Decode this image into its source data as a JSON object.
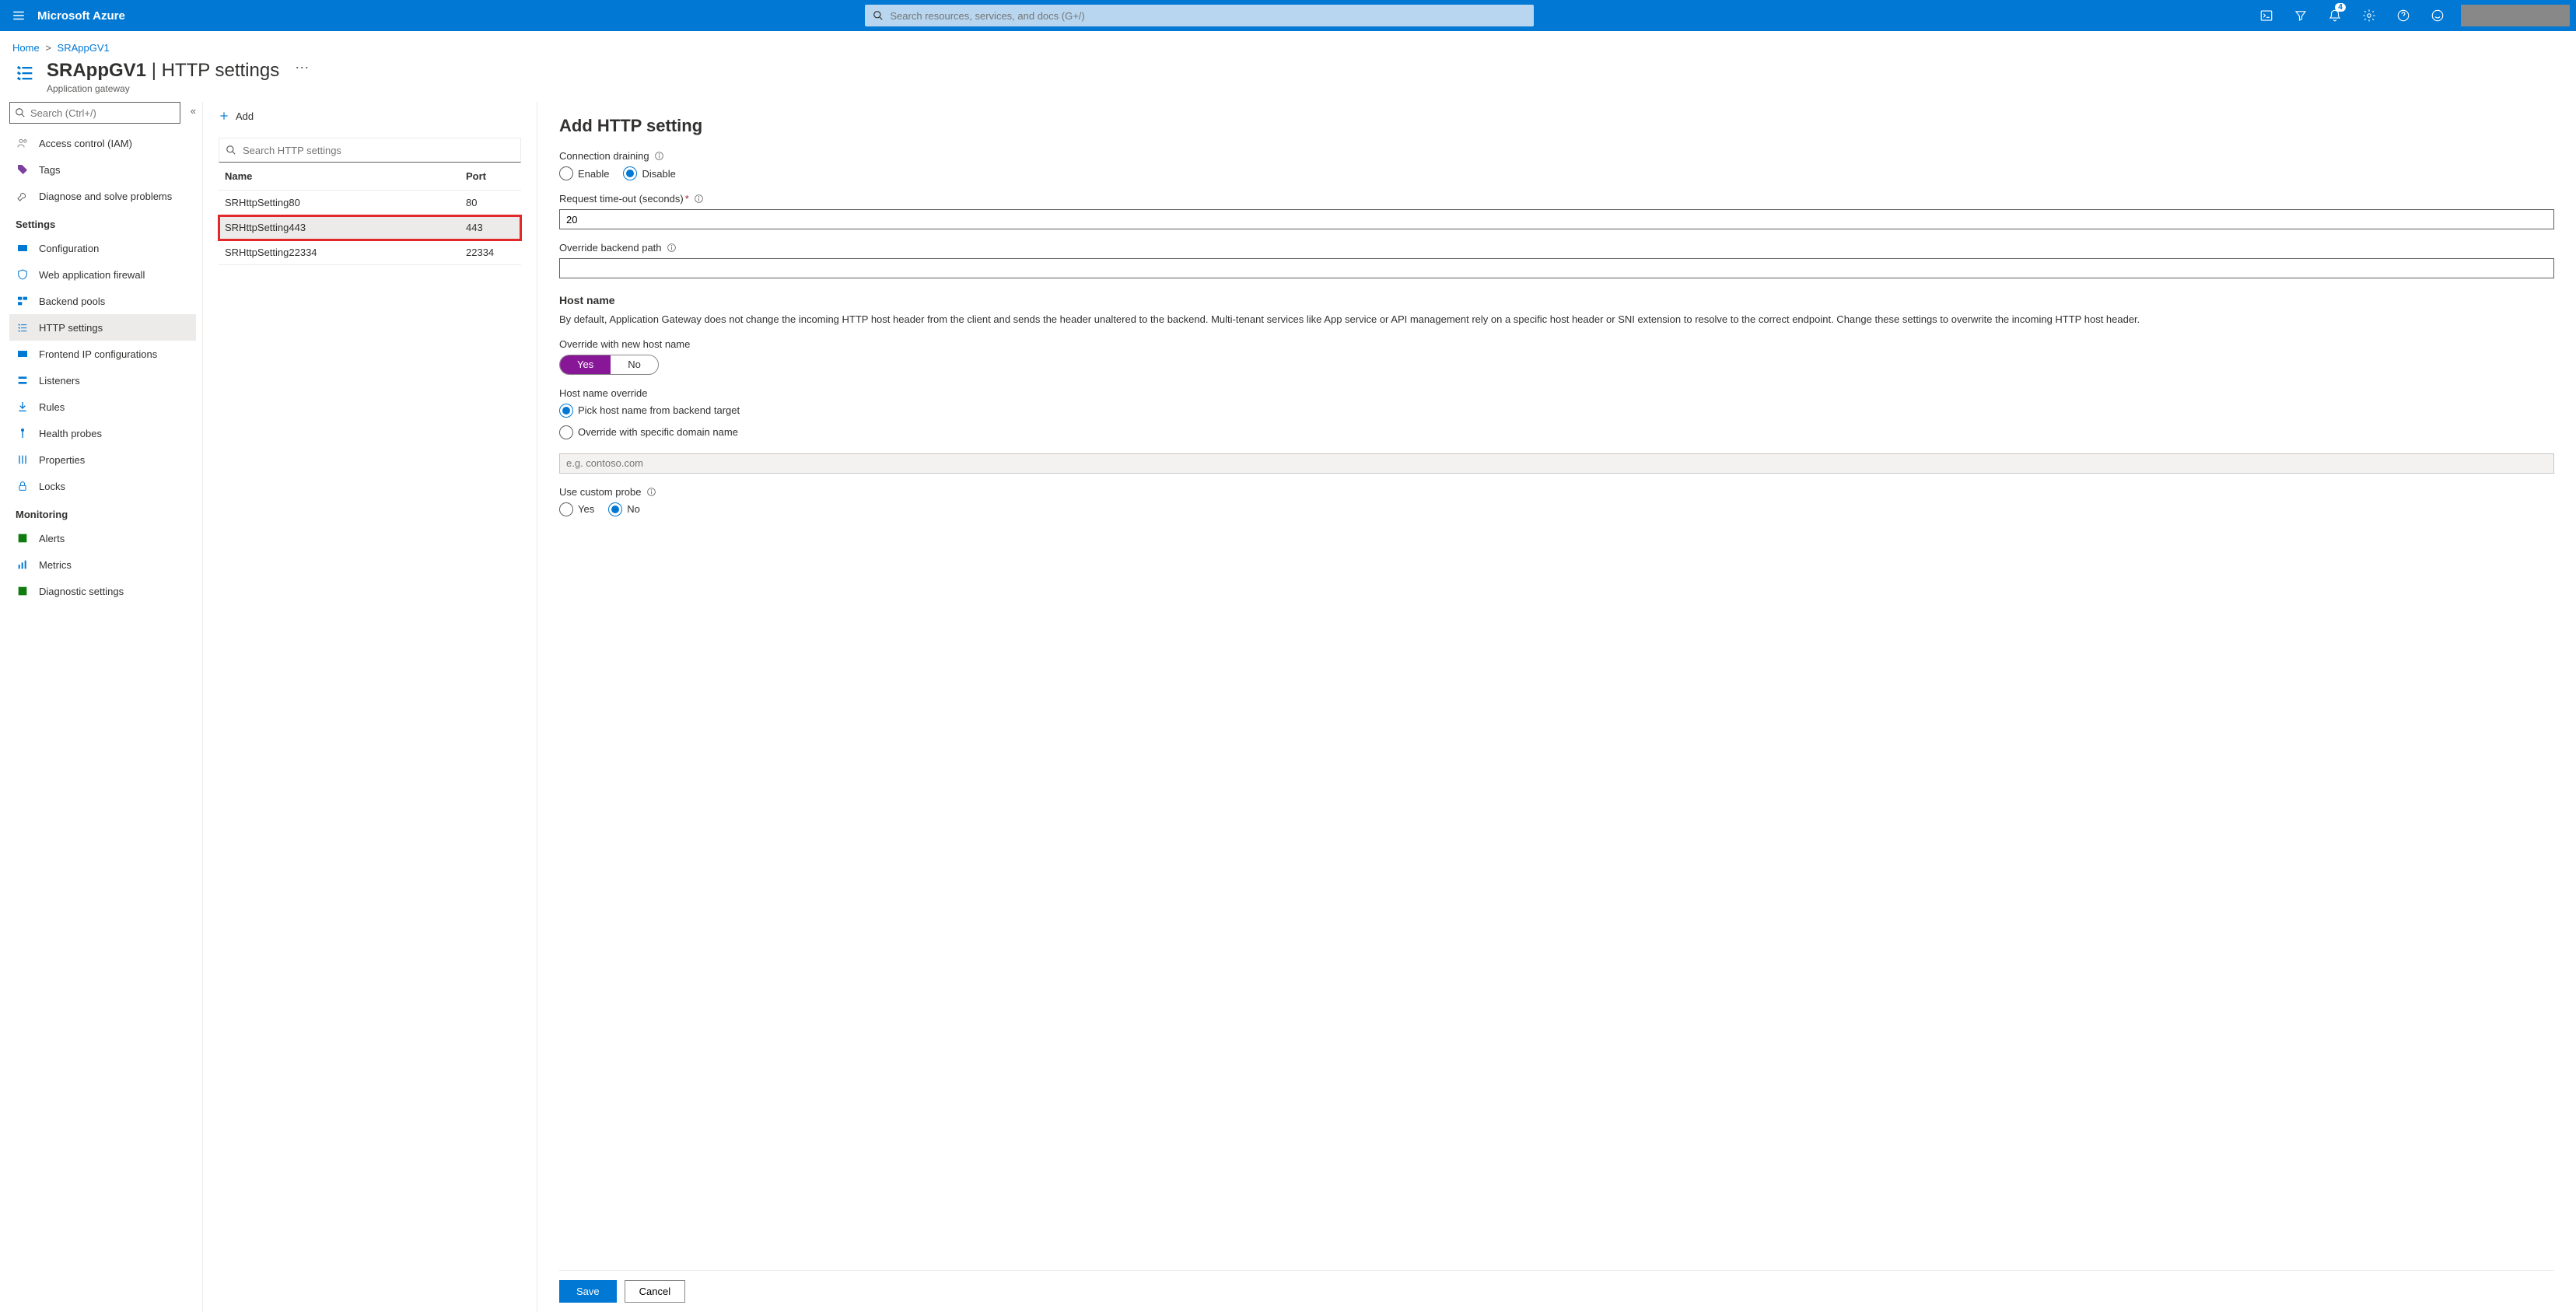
{
  "topbar": {
    "brand": "Microsoft Azure",
    "search_placeholder": "Search resources, services, and docs (G+/)",
    "notification_count": "4"
  },
  "breadcrumb": {
    "home": "Home",
    "resource": "SRAppGV1"
  },
  "header": {
    "resource": "SRAppGV1",
    "blade": "HTTP settings",
    "subtitle": "Application gateway"
  },
  "sidebar": {
    "search_placeholder": "Search (Ctrl+/)",
    "items_top": [
      {
        "label": "Access control (IAM)"
      },
      {
        "label": "Tags"
      },
      {
        "label": "Diagnose and solve problems"
      }
    ],
    "section_settings": "Settings",
    "items_settings": [
      {
        "label": "Configuration"
      },
      {
        "label": "Web application firewall"
      },
      {
        "label": "Backend pools"
      },
      {
        "label": "HTTP settings"
      },
      {
        "label": "Frontend IP configurations"
      },
      {
        "label": "Listeners"
      },
      {
        "label": "Rules"
      },
      {
        "label": "Health probes"
      },
      {
        "label": "Properties"
      },
      {
        "label": "Locks"
      }
    ],
    "section_monitoring": "Monitoring",
    "items_monitoring": [
      {
        "label": "Alerts"
      },
      {
        "label": "Metrics"
      },
      {
        "label": "Diagnostic settings"
      }
    ]
  },
  "middle": {
    "add_label": "Add",
    "filter_placeholder": "Search HTTP settings",
    "col_name": "Name",
    "col_port": "Port",
    "rows": [
      {
        "name": "SRHttpSetting80",
        "port": "80"
      },
      {
        "name": "SRHttpSetting443",
        "port": "443"
      },
      {
        "name": "SRHttpSetting22334",
        "port": "22334"
      }
    ]
  },
  "panel": {
    "title": "Add HTTP setting",
    "conn_drain_label": "Connection draining",
    "enable": "Enable",
    "disable": "Disable",
    "timeout_label": "Request time-out (seconds)",
    "timeout_value": "20",
    "override_path_label": "Override backend path",
    "hostname_head": "Host name",
    "hostname_desc": "By default, Application Gateway does not change the incoming HTTP host header from the client and sends the header unaltered to the backend. Multi-tenant services like App service or API management rely on a specific host header or SNI extension to resolve to the correct endpoint. Change these settings to overwrite the incoming HTTP host header.",
    "override_new_label": "Override with new host name",
    "yes": "Yes",
    "no": "No",
    "hostname_override_label": "Host name override",
    "pick_backend": "Pick host name from backend target",
    "override_specific": "Override with specific domain name",
    "domain_placeholder": "e.g. contoso.com",
    "custom_probe_label": "Use custom probe",
    "save": "Save",
    "cancel": "Cancel"
  }
}
